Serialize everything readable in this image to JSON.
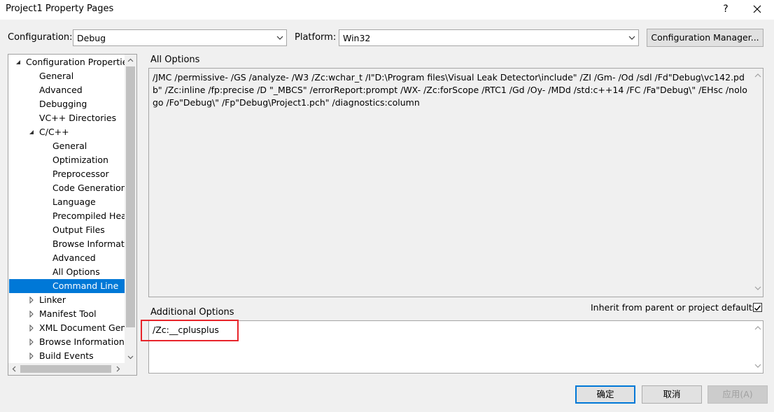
{
  "window": {
    "title": "Project1 Property Pages",
    "help_label": "?",
    "close_label": "✕"
  },
  "config": {
    "configuration_label": "Configuration:",
    "configuration_value": "Debug",
    "platform_label": "Platform:",
    "platform_value": "Win32",
    "manager_button": "Configuration Manager..."
  },
  "tree": {
    "items": [
      {
        "label": "Configuration Properties",
        "expanded": true
      },
      {
        "label": "General"
      },
      {
        "label": "Advanced"
      },
      {
        "label": "Debugging"
      },
      {
        "label": "VC++ Directories"
      },
      {
        "label": "C/C++",
        "expanded": true
      },
      {
        "label": "General"
      },
      {
        "label": "Optimization"
      },
      {
        "label": "Preprocessor"
      },
      {
        "label": "Code Generation"
      },
      {
        "label": "Language"
      },
      {
        "label": "Precompiled Heac"
      },
      {
        "label": "Output Files"
      },
      {
        "label": "Browse Informatic"
      },
      {
        "label": "Advanced"
      },
      {
        "label": "All Options"
      },
      {
        "label": "Command Line",
        "selected": true
      },
      {
        "label": "Linker"
      },
      {
        "label": "Manifest Tool"
      },
      {
        "label": "XML Document Gene"
      },
      {
        "label": "Browse Information"
      },
      {
        "label": "Build Events"
      }
    ]
  },
  "all_options": {
    "label": "All Options",
    "text": "/JMC /permissive- /GS /analyze- /W3 /Zc:wchar_t /I\"D:\\Program files\\Visual Leak Detector\\include\" /ZI /Gm- /Od /sdl /Fd\"Debug\\vc142.pdb\" /Zc:inline /fp:precise /D \"_MBCS\" /errorReport:prompt /WX- /Zc:forScope /RTC1 /Gd /Oy- /MDd /std:c++14 /FC /Fa\"Debug\\\" /EHsc /nologo /Fo\"Debug\\\" /Fp\"Debug\\Project1.pch\" /diagnostics:column"
  },
  "additional_options": {
    "label": "Additional Options",
    "value": "/Zc:__cplusplus",
    "inherit_label": "Inherit from parent or project defaults",
    "inherit_checked": true
  },
  "buttons": {
    "ok": "确定",
    "cancel": "取消",
    "apply": "应用(A)"
  },
  "colors": {
    "selection": "#0078d7",
    "highlight_box": "#e8252b"
  }
}
